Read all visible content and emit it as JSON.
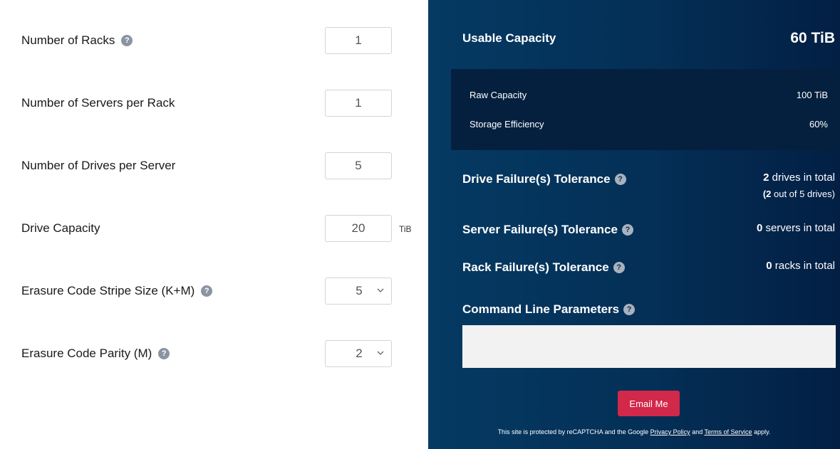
{
  "form": {
    "racks": {
      "label": "Number of Racks",
      "value": "1",
      "help": "?"
    },
    "servers": {
      "label": "Number of Servers per Rack",
      "value": "1"
    },
    "drives": {
      "label": "Number of Drives per Server",
      "value": "5"
    },
    "capacity": {
      "label": "Drive Capacity",
      "value": "20",
      "unit": "TiB"
    },
    "stripe": {
      "label": "Erasure Code Stripe Size (K+M)",
      "value": "5",
      "help": "?"
    },
    "parity": {
      "label": "Erasure Code Parity (M)",
      "value": "2",
      "help": "?"
    }
  },
  "results": {
    "usable_label": "Usable Capacity",
    "usable_value": "60 TiB",
    "raw_label": "Raw Capacity",
    "raw_value": "100 TiB",
    "efficiency_label": "Storage Efficiency",
    "efficiency_value": "60%",
    "drive_tol_label": "Drive Failure(s) Tolerance",
    "drive_tol_count": "2",
    "drive_tol_text": " drives in total",
    "drive_tol_sub_open": "(",
    "drive_tol_sub_count": "2",
    "drive_tol_sub_text": " out of 5 drives)",
    "server_tol_label": "Server Failure(s) Tolerance",
    "server_tol_count": "0",
    "server_tol_text": " servers in total",
    "rack_tol_label": "Rack Failure(s) Tolerance",
    "rack_tol_count": "0",
    "rack_tol_text": " racks in total",
    "cli_label": "Command Line Parameters",
    "help": "?"
  },
  "email_button": "Email Me",
  "recaptcha": {
    "prefix": "This site is protected by reCAPTCHA and the Google ",
    "privacy": "Privacy Policy",
    "and": " and ",
    "terms": "Terms of Service",
    "suffix": " apply."
  },
  "colors": {
    "accent": "#d2284a",
    "panel_dark": "#05203f",
    "bg_navy": "#042f56"
  }
}
